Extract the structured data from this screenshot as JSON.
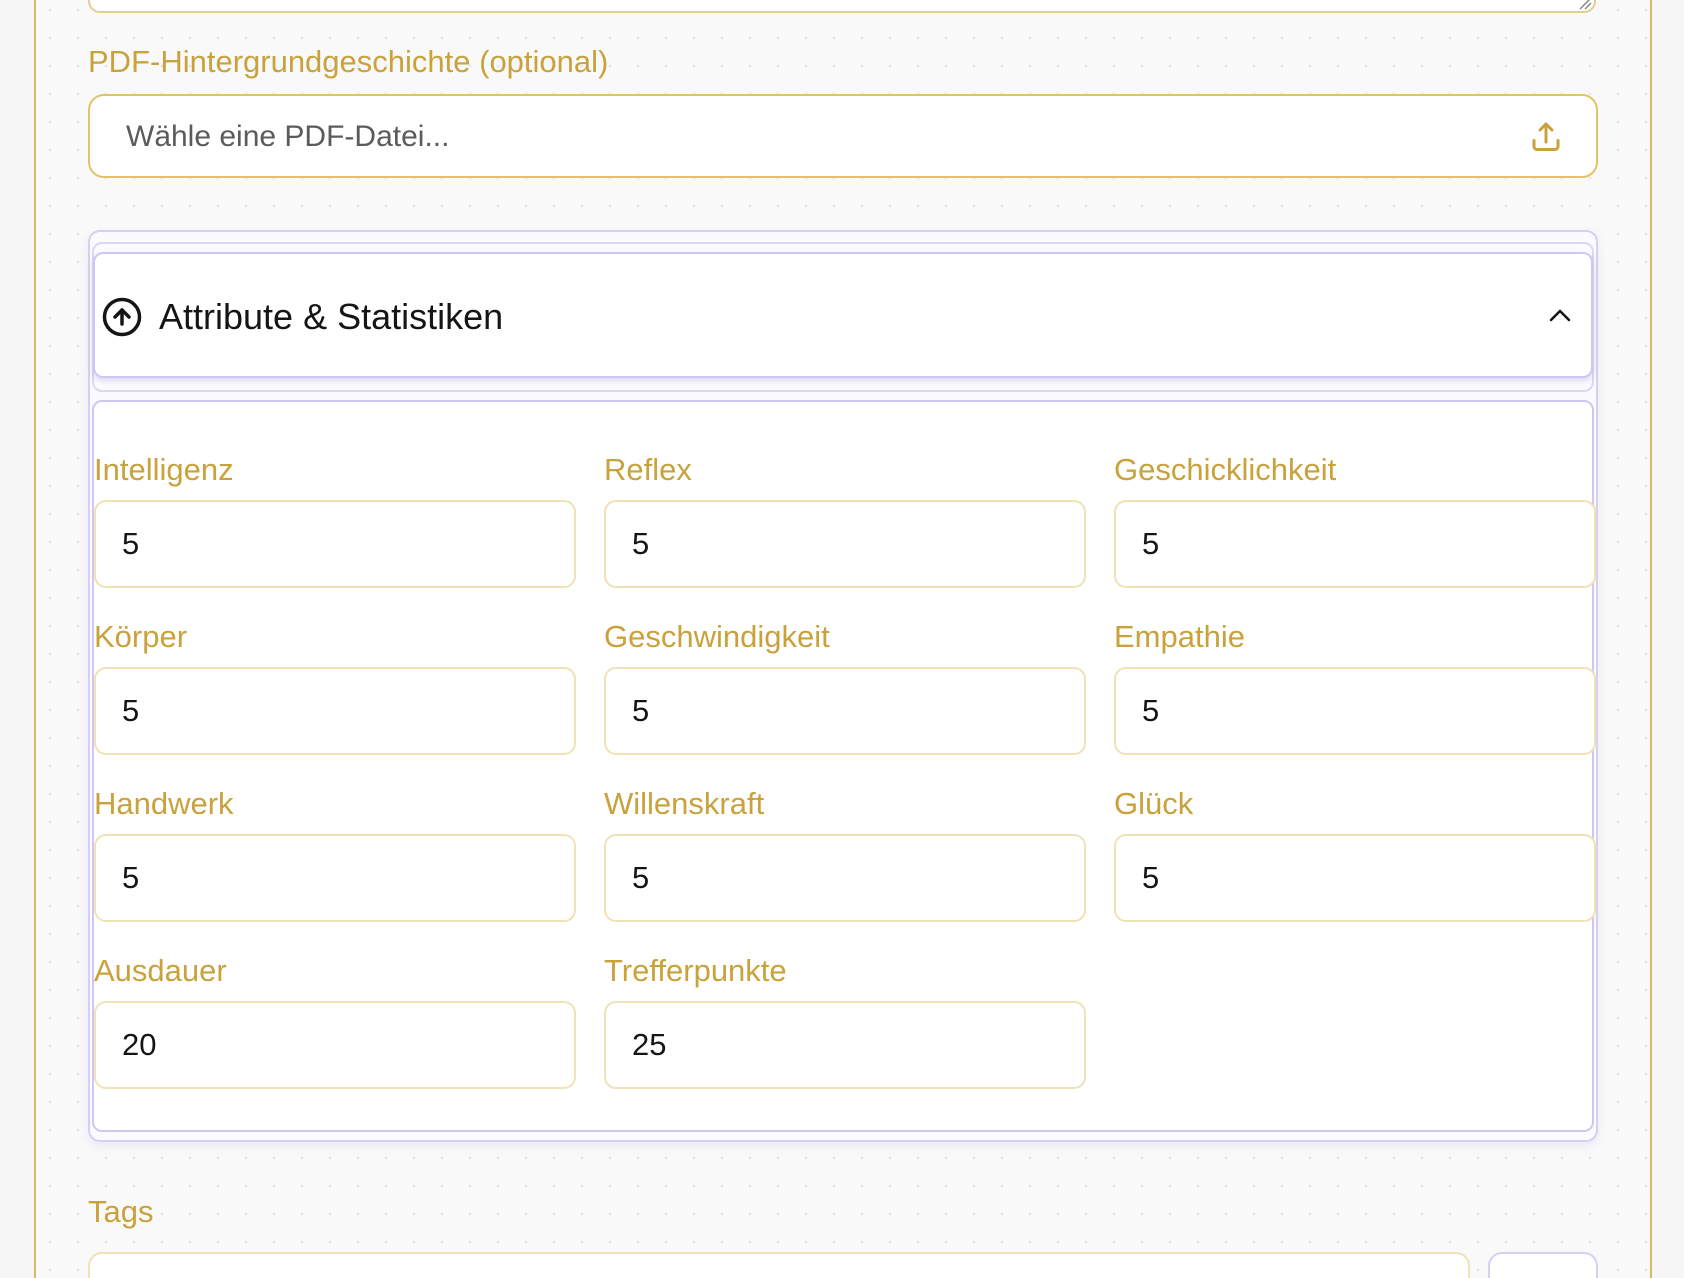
{
  "form": {
    "pdf_label": "PDF-Hintergrundgeschichte (optional)",
    "pdf_placeholder": "Wähle eine PDF-Datei...",
    "pdf_icon": "upload-icon",
    "tags_label": "Tags"
  },
  "attributes": {
    "title": "Attribute & Statistiken",
    "header_icon": "arrow-up-circle-icon",
    "toggle_icon": "chevron-up-icon",
    "expanded": true,
    "fields": [
      {
        "label": "Intelligenz",
        "value": "5"
      },
      {
        "label": "Reflex",
        "value": "5"
      },
      {
        "label": "Geschicklichkeit",
        "value": "5"
      },
      {
        "label": "Körper",
        "value": "5"
      },
      {
        "label": "Geschwindigkeit",
        "value": "5"
      },
      {
        "label": "Empathie",
        "value": "5"
      },
      {
        "label": "Handwerk",
        "value": "5"
      },
      {
        "label": "Willenskraft",
        "value": "5"
      },
      {
        "label": "Glück",
        "value": "5"
      },
      {
        "label": "Ausdauer",
        "value": "20"
      },
      {
        "label": "Trefferpunkte",
        "value": "25"
      }
    ]
  },
  "colors": {
    "accent_gold": "#c9a23c",
    "accent_border": "#e0c465",
    "accordion_border": "#cfc7f2",
    "text": "#151515"
  }
}
